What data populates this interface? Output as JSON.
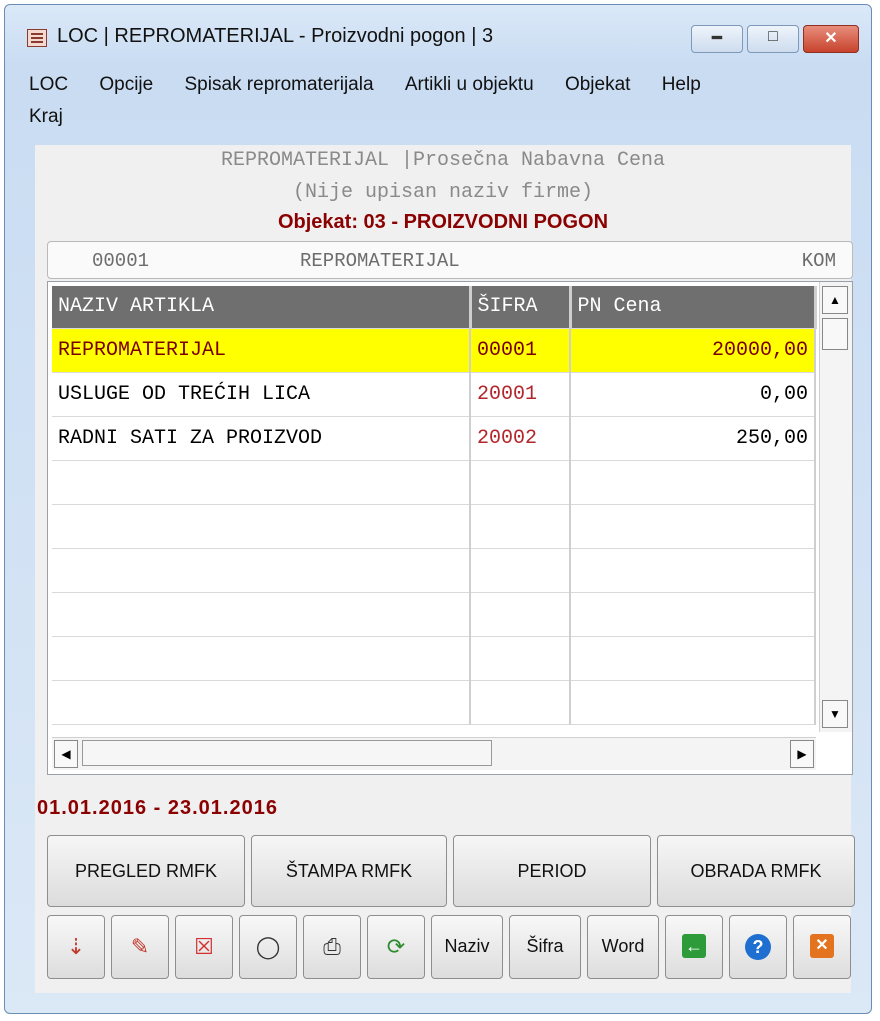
{
  "window": {
    "title": "LOC | REPROMATERIJAL - Proizvodni pogon | 3"
  },
  "menu": [
    "LOC",
    "Opcije",
    "Spisak repromaterijala",
    "Artikli u objektu",
    "Objekat",
    "Help",
    "Kraj"
  ],
  "header": {
    "line1": "REPROMATERIJAL |Prosečna Nabavna Cena",
    "line2": "(Nije upisan naziv firme)",
    "object": "Objekat:  03 - PROIZVODNI POGON"
  },
  "info": {
    "code": "00001",
    "name": "REPROMATERIJAL",
    "unit": "KOM"
  },
  "table": {
    "columns": [
      "NAZIV ARTIKLA",
      "ŠIFRA",
      "PN Cena"
    ],
    "rows": [
      {
        "name": "REPROMATERIJAL",
        "code": "00001",
        "price": "20000,00"
      },
      {
        "name": "USLUGE OD TREĆIH LICA",
        "code": "20001",
        "price": "0,00"
      },
      {
        "name": "RADNI SATI ZA PROIZVOD",
        "code": "20002",
        "price": "250,00"
      }
    ]
  },
  "period": "01.01.2016 - 23.01.2016",
  "buttons": [
    "PREGLED RMFK",
    "ŠTAMPA RMFK",
    "PERIOD",
    "OBRADA RMFK"
  ],
  "toolbar": {
    "naziv": "Naziv",
    "sifra": "Šifra",
    "word": "Word"
  },
  "icons": [
    "import-icon",
    "edit-icon",
    "delete-icon",
    "view-icon",
    "print-icon",
    "refresh-icon",
    "back-icon",
    "help-icon",
    "exit-icon"
  ],
  "colors": {
    "highlight": "#ffff00",
    "accent": "#8b0000",
    "header_bg": "#6f6f6f"
  }
}
